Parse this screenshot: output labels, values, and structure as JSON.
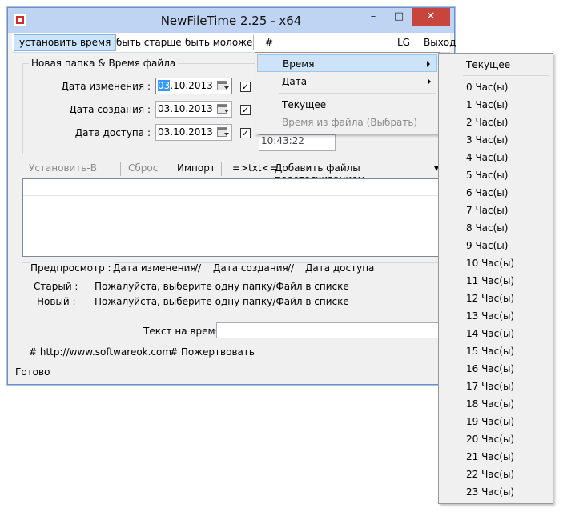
{
  "window": {
    "title": "NewFileTime 2.25 - x64",
    "min": "–",
    "max": "□",
    "close": "✕"
  },
  "menubar": {
    "set_time": "установить время",
    "older": "быть старше",
    "younger": "быть моложе",
    "hash": "#",
    "lang": "LG",
    "exit": "Выход"
  },
  "group": {
    "title": "Новая папка & Время файла",
    "modified_label": "Дата изменения :",
    "created_label": "Дата создания :",
    "accessed_label": "Дата доступа :",
    "modified_sel": "03",
    "modified_rest": ".10.2013",
    "created": "03.10.2013",
    "accessed": "03.10.2013",
    "time_partial": "10:43:22",
    "check": "✓"
  },
  "toolbar": {
    "set_in": "Установить-В",
    "reset": "Сброс",
    "import": "Импорт",
    "txt": "=>txt<=",
    "add_drag": "Добавить файлы перетаскиванием",
    "dropdown": "▾"
  },
  "preview": {
    "title": "Предпросмотр :",
    "col1": "Дата изменения",
    "sep1": "//",
    "col2": "Дата создания",
    "sep2": "//",
    "col3": "Дата доступа",
    "old_label": "Старый :",
    "new_label": "Новый :",
    "old_msg": "Пожалуйста, выберите одну папку/Файл в списке",
    "new_msg": "Пожалуйста, выберите одну папку/Файл в списке"
  },
  "text_time_label": "Текст на время",
  "links": {
    "site": "# http://www.softwareok.com",
    "donate": "# Пожертвовать"
  },
  "status": "Готово",
  "menu1": {
    "time": "Время",
    "date": "Дата",
    "current": "Текущее",
    "from_file": "Время из файла (Выбрать)"
  },
  "menu2": {
    "current": "Текущее",
    "hours": [
      "0 Час(ы)",
      "1 Час(ы)",
      "2 Час(ы)",
      "3 Час(ы)",
      "4 Час(ы)",
      "5 Час(ы)",
      "6 Час(ы)",
      "7 Час(ы)",
      "8 Час(ы)",
      "9 Час(ы)",
      "10 Час(ы)",
      "11 Час(ы)",
      "12 Час(ы)",
      "13 Час(ы)",
      "14 Час(ы)",
      "15 Час(ы)",
      "16 Час(ы)",
      "17 Час(ы)",
      "18 Час(ы)",
      "19 Час(ы)",
      "20 Час(ы)",
      "21 Час(ы)",
      "22 Час(ы)",
      "23 Час(ы)"
    ]
  }
}
